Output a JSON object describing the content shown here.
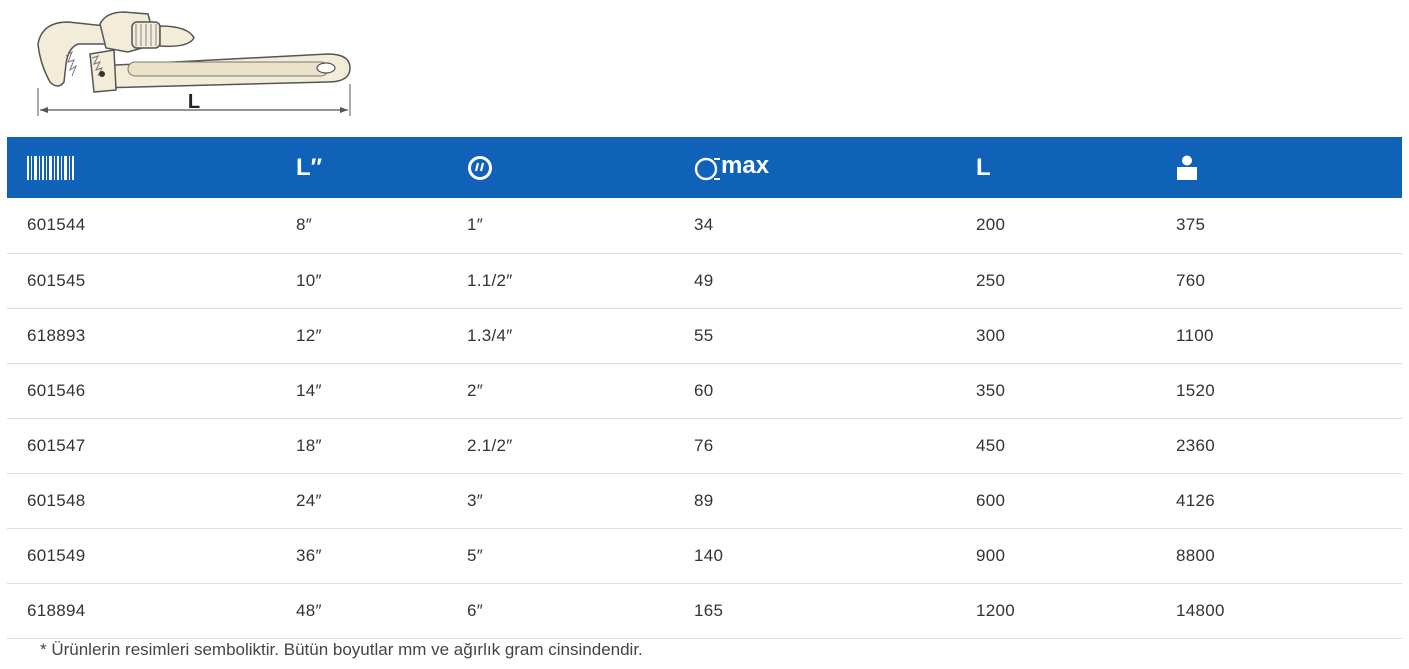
{
  "illustration": {
    "dimension_label": "L",
    "icon": "pipe-wrench-drawing"
  },
  "table": {
    "header_color": "#0f62b8",
    "headers": [
      {
        "icon": "barcode-icon",
        "label": ""
      },
      {
        "icon": "",
        "label": "L″"
      },
      {
        "icon": "pipe-size-icon",
        "label": ""
      },
      {
        "icon": "pipe-diameter-icon",
        "label": "max"
      },
      {
        "icon": "",
        "label": "L"
      },
      {
        "icon": "weight-icon",
        "label": ""
      }
    ],
    "rows": [
      [
        "601544",
        "8″",
        "1″",
        "34",
        "200",
        "375"
      ],
      [
        "601545",
        "10″",
        "1.1/2″",
        "49",
        "250",
        "760"
      ],
      [
        "618893",
        "12″",
        "1.3/4″",
        "55",
        "300",
        "1100"
      ],
      [
        "601546",
        "14″",
        "2″",
        "60",
        "350",
        "1520"
      ],
      [
        "601547",
        "18″",
        "2.1/2″",
        "76",
        "450",
        "2360"
      ],
      [
        "601548",
        "24″",
        "3″",
        "89",
        "600",
        "4126"
      ],
      [
        "601549",
        "36″",
        "5″",
        "140",
        "900",
        "8800"
      ],
      [
        "618894",
        "48″",
        "6″",
        "165",
        "1200",
        "14800"
      ]
    ]
  },
  "footnote": "* Ürünlerin resimleri semboliktir. Bütün boyutlar mm ve ağırlık gram cinsindendir."
}
